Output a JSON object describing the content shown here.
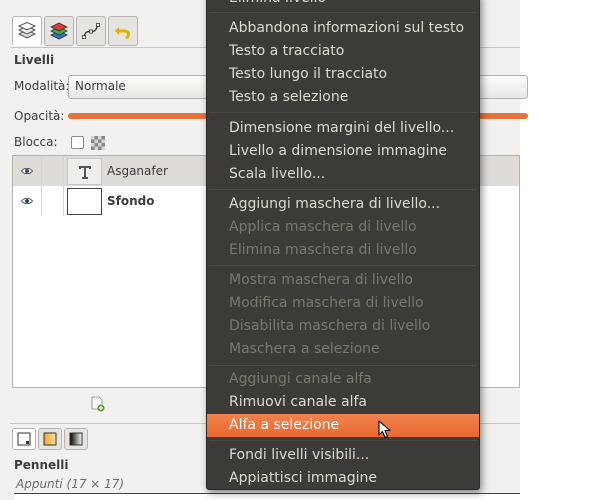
{
  "dock": {
    "tabs": [
      {
        "icon": "layers-icon"
      },
      {
        "icon": "channels-icon"
      },
      {
        "icon": "paths-icon"
      },
      {
        "icon": "undo-history-icon"
      }
    ],
    "title": "Livelli",
    "mode_label": "Modalità:",
    "mode_value": "Normale",
    "opacity_label": "Opacità:",
    "opacity_fraction": 1.0,
    "lock_label": "Blocca:",
    "layers": [
      {
        "name": "Asganafer",
        "type": "text",
        "selected": true
      },
      {
        "name": "Sfondo",
        "type": "raster",
        "selected": false
      }
    ],
    "brushes": {
      "title": "Pennelli",
      "subtitle": "Appunti (17 × 17)"
    }
  },
  "menu": {
    "top_partial": "Elimina livello",
    "items": [
      {
        "label": "Abbandona informazioni sul testo",
        "state": "normal"
      },
      {
        "label": "Testo a tracciato",
        "state": "normal"
      },
      {
        "label": "Testo lungo il tracciato",
        "state": "normal"
      },
      {
        "label": "Testo a selezione",
        "state": "normal"
      },
      {
        "label": "Dimensione margini del livello...",
        "state": "normal"
      },
      {
        "label": "Livello a dimensione immagine",
        "state": "normal"
      },
      {
        "label": "Scala livello...",
        "state": "normal"
      },
      {
        "label": "Aggiungi maschera di livello...",
        "state": "normal"
      },
      {
        "label": "Applica maschera di livello",
        "state": "disabled"
      },
      {
        "label": "Elimina maschera di livello",
        "state": "disabled"
      },
      {
        "label": "Mostra maschera di livello",
        "state": "disabled"
      },
      {
        "label": "Modifica maschera di livello",
        "state": "disabled"
      },
      {
        "label": "Disabilita maschera di livello",
        "state": "disabled"
      },
      {
        "label": "Maschera a selezione",
        "state": "disabled"
      },
      {
        "label": "Aggiungi canale alfa",
        "state": "disabled"
      },
      {
        "label": "Rimuovi canale alfa",
        "state": "normal"
      },
      {
        "label": "Alfa a selezione",
        "state": "highlighted"
      },
      {
        "label": "Fondi livelli visibili...",
        "state": "normal"
      },
      {
        "label": "Appiattisci immagine",
        "state": "normal"
      }
    ]
  },
  "colors": {
    "accent": "#e9682f",
    "menu_bg": "#3c3b37",
    "menu_text": "#dfdbd2",
    "menu_disabled": "#7a776f"
  }
}
